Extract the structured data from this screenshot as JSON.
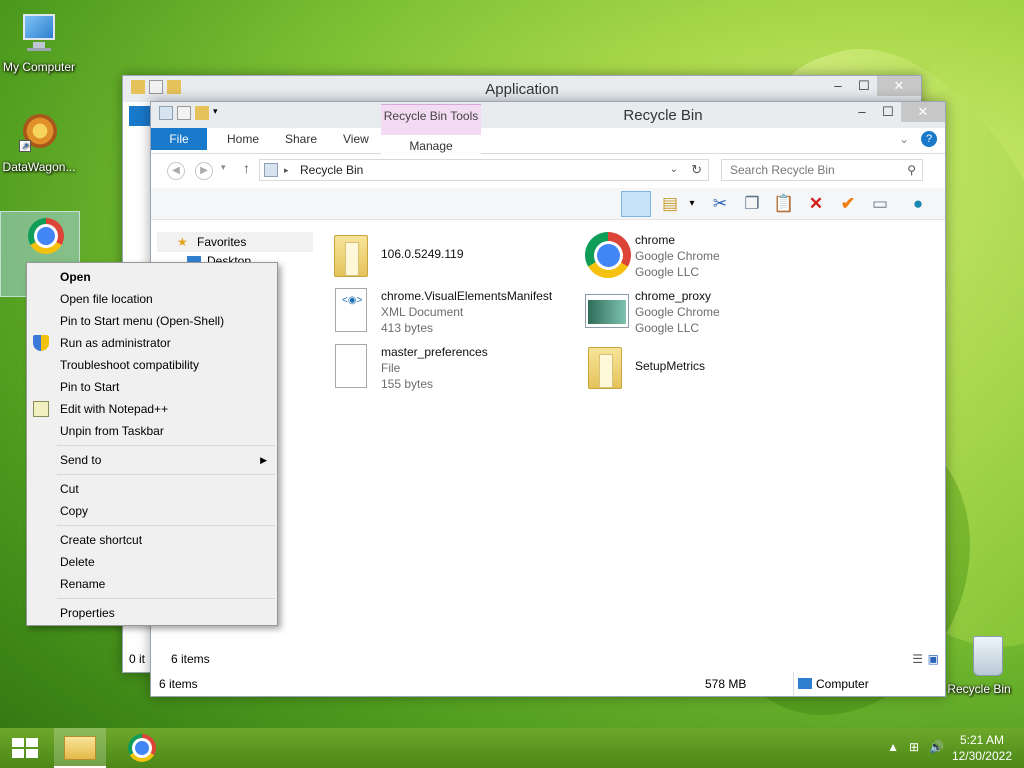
{
  "desktop": {
    "icons": [
      {
        "label": "My Computer"
      },
      {
        "label": "DataWagon..."
      },
      {
        "label": "Recycle Bin"
      }
    ]
  },
  "back_window": {
    "title": "Application",
    "status_count": "0 it"
  },
  "window": {
    "title": "Recycle Bin",
    "context_tab_group": "Recycle Bin Tools",
    "tabs": [
      "File",
      "Home",
      "Share",
      "View",
      "Manage"
    ],
    "address": "Recycle Bin",
    "search_placeholder": "Search Recycle Bin",
    "nav": {
      "favorites": "Favorites",
      "desktop": "Desktop"
    },
    "files": [
      {
        "name": "106.0.5249.119",
        "line2": "",
        "line3": "",
        "icon": "folder-icon"
      },
      {
        "name": "chrome",
        "line2": "Google Chrome",
        "line3": "Google LLC",
        "icon": "chrome-icon"
      },
      {
        "name": "chrome.VisualElementsManifest",
        "line2": "XML Document",
        "line3": "413 bytes",
        "icon": "xml-document-icon"
      },
      {
        "name": "chrome_proxy",
        "line2": "Google Chrome",
        "line3": "Google LLC",
        "icon": "application-icon"
      },
      {
        "name": "master_preferences",
        "line2": "File",
        "line3": "155 bytes",
        "icon": "file-icon"
      },
      {
        "name": "SetupMetrics",
        "line2": "",
        "line3": "",
        "icon": "folder-icon"
      }
    ],
    "inner_status": "6 items",
    "status_left": "6 items",
    "status_size": "578 MB",
    "status_location": "Computer"
  },
  "context_menu": {
    "items": [
      {
        "label": "Open",
        "bold": true
      },
      {
        "label": "Open file location"
      },
      {
        "label": "Pin to Start menu (Open-Shell)"
      },
      {
        "label": "Run as administrator",
        "icon": "shield-icon"
      },
      {
        "label": "Troubleshoot compatibility"
      },
      {
        "label": "Pin to Start"
      },
      {
        "label": "Edit with Notepad++",
        "icon": "notepad-icon"
      },
      {
        "label": "Unpin from Taskbar"
      },
      {
        "label": "Send to",
        "submenu": true
      },
      {
        "label": "Cut"
      },
      {
        "label": "Copy"
      },
      {
        "label": "Create shortcut"
      },
      {
        "label": "Delete"
      },
      {
        "label": "Rename"
      },
      {
        "label": "Properties"
      }
    ]
  },
  "taskbar": {
    "time": "5:21 AM",
    "date": "12/30/2022"
  },
  "colors": {
    "accent": "#1979ca",
    "context_tab": "#f3dcf3",
    "taskbar": "#5a951f"
  }
}
